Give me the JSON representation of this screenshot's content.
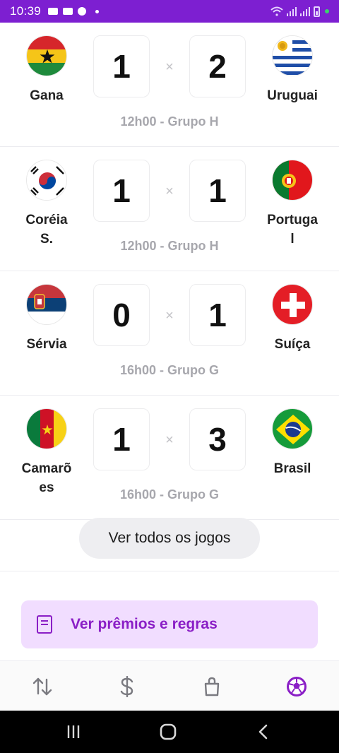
{
  "status_bar": {
    "time": "10:39"
  },
  "matches": [
    {
      "home": {
        "name": "Gana",
        "flag": "ghana-flag"
      },
      "away": {
        "name": "Uruguai",
        "flag": "uruguay-flag"
      },
      "home_score": "1",
      "away_score": "2",
      "separator": "×",
      "info": "12h00 - Grupo H"
    },
    {
      "home": {
        "name": "Coréia S.",
        "flag": "south-korea-flag"
      },
      "away": {
        "name": "Portugal",
        "flag": "portugal-flag"
      },
      "home_score": "1",
      "away_score": "1",
      "separator": "×",
      "info": "12h00 - Grupo H"
    },
    {
      "home": {
        "name": "Sérvia",
        "flag": "serbia-flag"
      },
      "away": {
        "name": "Suíça",
        "flag": "switzerland-flag"
      },
      "home_score": "0",
      "away_score": "1",
      "separator": "×",
      "info": "16h00 - Grupo G"
    },
    {
      "home": {
        "name": "Camarões",
        "flag": "cameroon-flag"
      },
      "away": {
        "name": "Brasil",
        "flag": "brazil-flag"
      },
      "home_score": "1",
      "away_score": "3",
      "separator": "×",
      "info": "16h00 - Grupo G"
    }
  ],
  "see_all_label": "Ver todos os jogos",
  "prizes_label": "Ver prêmios e regras",
  "tabs": [
    {
      "icon": "transfer-arrows-icon"
    },
    {
      "icon": "dollar-icon"
    },
    {
      "icon": "shopping-bag-icon"
    },
    {
      "icon": "soccer-ball-icon",
      "active": true
    }
  ],
  "colors": {
    "brand": "#7d1fd1",
    "prizes_bg": "#f1ddff",
    "prizes_text": "#8a1ec6",
    "info_text": "#a7a7ad"
  }
}
